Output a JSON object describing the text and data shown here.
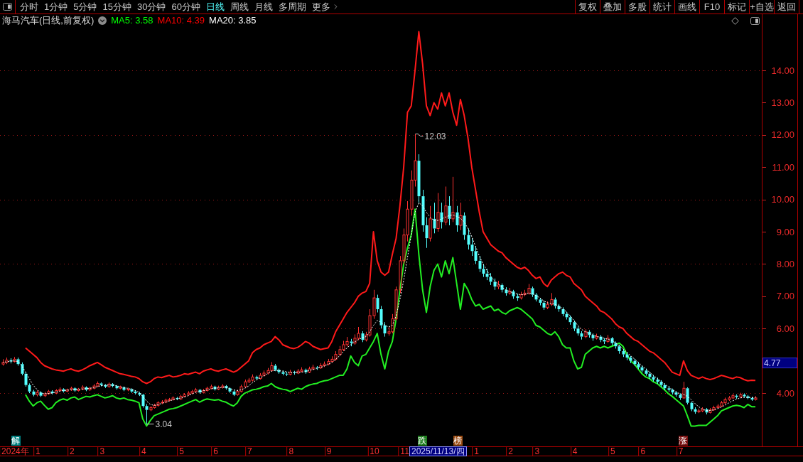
{
  "toolbar": {
    "periods": [
      {
        "label": "分时",
        "selected": false,
        "kind": "tab"
      },
      {
        "label": "1分钟",
        "selected": false,
        "kind": "tab"
      },
      {
        "label": "5分钟",
        "selected": false,
        "kind": "tab"
      },
      {
        "label": "15分钟",
        "selected": false,
        "kind": "tab"
      },
      {
        "label": "30分钟",
        "selected": false,
        "kind": "tab"
      },
      {
        "label": "60分钟",
        "selected": false,
        "kind": "tab"
      },
      {
        "label": "日线",
        "selected": true,
        "kind": "tab"
      },
      {
        "label": "周线",
        "selected": false,
        "kind": "tab"
      },
      {
        "label": "月线",
        "selected": false,
        "kind": "tab"
      },
      {
        "label": "多周期",
        "selected": false,
        "kind": "tab"
      },
      {
        "label": "更多",
        "selected": false,
        "kind": "menu"
      }
    ],
    "actions": [
      "复权",
      "叠加",
      "多股",
      "统计",
      "画线",
      "F10",
      "标记",
      "+自选",
      "返回"
    ]
  },
  "chart": {
    "title": "海马汽车(日线,前复权)",
    "indicators": [
      {
        "text": "MA5: 3.58",
        "color": "#00ff00"
      },
      {
        "text": "MA10: 4.39",
        "color": "#ff0000"
      },
      {
        "text": "MA20: 3.85",
        "color": "#ffffff"
      }
    ],
    "current_price": "4.77",
    "event_flags": [
      {
        "text": "解",
        "color": "#008080"
      },
      {
        "text": "跌",
        "color": "#1e7d1e"
      },
      {
        "text": "榜",
        "color": "#9a4a10"
      },
      {
        "text": "涨",
        "color": "#7a1010"
      }
    ],
    "cursor_date": "2025/11/13/四",
    "chart_data": [
      {
        "type": "candlestick",
        "categories": [
          null,
          null,
          null,
          "2024年",
          null,
          null,
          null,
          null,
          null,
          "1",
          null,
          null,
          null,
          null,
          null,
          null,
          null,
          null,
          "2",
          null,
          null,
          null,
          null,
          null,
          null,
          null,
          "3",
          null,
          null,
          null,
          null,
          null,
          null,
          null,
          null,
          null,
          null,
          "4",
          null,
          null,
          null,
          null,
          null,
          null,
          null,
          null,
          null,
          "5",
          null,
          null,
          null,
          null,
          null,
          null,
          null,
          null,
          "6",
          null,
          null,
          null,
          null,
          null,
          null,
          null,
          null,
          "7",
          null,
          null,
          null,
          null,
          null,
          null,
          null,
          null,
          null,
          null,
          "8",
          null,
          null,
          null,
          null,
          null,
          null,
          null,
          null,
          null,
          "9",
          null,
          null,
          null,
          null,
          null,
          null,
          null,
          null,
          null,
          null,
          null,
          "10",
          null,
          null,
          null,
          null,
          null,
          null,
          null,
          "11",
          null,
          null,
          null,
          null,
          null,
          null,
          null,
          null,
          null,
          null,
          null,
          null,
          null,
          null,
          null,
          null,
          null,
          null,
          "1",
          null,
          null,
          null,
          null,
          null,
          null,
          null,
          null,
          "2",
          null,
          null,
          null,
          null,
          null,
          null,
          "3",
          null,
          null,
          null,
          null,
          null,
          null,
          null,
          null,
          null,
          "4",
          null,
          null,
          null,
          null,
          null,
          null,
          null,
          null,
          null,
          "5",
          null,
          null,
          null,
          null,
          null,
          null,
          null,
          "6",
          null,
          null,
          null,
          null,
          null,
          null,
          null,
          null,
          null,
          "7",
          null,
          null,
          null,
          null,
          null,
          null,
          null,
          null,
          null,
          null,
          null,
          null,
          null,
          null,
          null,
          null,
          null,
          null,
          null,
          null
        ],
        "ohlc": [
          [
            4.9,
            5.05,
            4.85,
            4.95
          ],
          [
            4.95,
            5.1,
            4.9,
            5.02
          ],
          [
            5.02,
            5.08,
            4.92,
            4.98
          ],
          [
            4.98,
            5.12,
            4.95,
            5.05
          ],
          [
            5.05,
            5.1,
            4.85,
            4.9
          ],
          [
            4.9,
            4.95,
            4.55,
            4.6
          ],
          [
            4.6,
            4.65,
            4.2,
            4.25
          ],
          [
            4.25,
            4.3,
            4.0,
            4.05
          ],
          [
            4.05,
            4.1,
            3.9,
            3.95
          ],
          [
            3.95,
            4.08,
            3.9,
            4.02
          ],
          [
            4.02,
            4.06,
            3.88,
            3.92
          ],
          [
            3.92,
            4.04,
            3.88,
            3.98
          ],
          [
            3.98,
            4.1,
            3.95,
            4.05
          ],
          [
            4.05,
            4.09,
            3.96,
            4.0
          ],
          [
            4.0,
            4.12,
            3.97,
            4.08
          ],
          [
            4.08,
            4.18,
            4.04,
            4.12
          ],
          [
            4.12,
            4.15,
            4.02,
            4.06
          ],
          [
            4.06,
            4.14,
            4.03,
            4.1
          ],
          [
            4.1,
            4.2,
            4.07,
            4.15
          ],
          [
            4.15,
            4.18,
            4.04,
            4.08
          ],
          [
            4.08,
            4.16,
            4.05,
            4.12
          ],
          [
            4.12,
            4.24,
            4.09,
            4.18
          ],
          [
            4.18,
            4.21,
            4.06,
            4.1
          ],
          [
            4.1,
            4.19,
            4.07,
            4.15
          ],
          [
            4.15,
            4.28,
            4.12,
            4.22
          ],
          [
            4.22,
            4.36,
            4.19,
            4.3
          ],
          [
            4.3,
            4.33,
            4.21,
            4.25
          ],
          [
            4.25,
            4.28,
            4.16,
            4.2
          ],
          [
            4.2,
            4.33,
            4.17,
            4.28
          ],
          [
            4.28,
            4.31,
            4.18,
            4.22
          ],
          [
            4.22,
            4.25,
            4.11,
            4.15
          ],
          [
            4.15,
            4.23,
            4.12,
            4.18
          ],
          [
            4.18,
            4.21,
            4.06,
            4.1
          ],
          [
            4.1,
            4.17,
            4.06,
            4.12
          ],
          [
            4.12,
            4.15,
            4.01,
            4.05
          ],
          [
            4.05,
            4.09,
            3.96,
            4.0
          ],
          [
            4.0,
            4.04,
            3.91,
            3.95
          ],
          [
            3.95,
            3.98,
            3.55,
            3.6
          ],
          [
            3.6,
            3.66,
            3.04,
            3.48
          ],
          [
            3.48,
            3.6,
            3.44,
            3.55
          ],
          [
            3.55,
            3.67,
            3.52,
            3.62
          ],
          [
            3.62,
            3.75,
            3.58,
            3.7
          ],
          [
            3.7,
            3.78,
            3.66,
            3.72
          ],
          [
            3.72,
            3.83,
            3.69,
            3.78
          ],
          [
            3.78,
            3.85,
            3.74,
            3.8
          ],
          [
            3.8,
            3.9,
            3.77,
            3.85
          ],
          [
            3.85,
            3.88,
            3.78,
            3.82
          ],
          [
            3.82,
            3.95,
            3.79,
            3.9
          ],
          [
            3.9,
            4.0,
            3.87,
            3.95
          ],
          [
            3.95,
            4.06,
            3.92,
            4.0
          ],
          [
            4.0,
            4.1,
            3.97,
            4.05
          ],
          [
            4.05,
            4.16,
            4.02,
            4.1
          ],
          [
            4.1,
            4.13,
            3.98,
            4.02
          ],
          [
            4.02,
            4.13,
            3.99,
            4.08
          ],
          [
            4.08,
            4.2,
            4.05,
            4.15
          ],
          [
            4.15,
            4.26,
            4.12,
            4.2
          ],
          [
            4.2,
            4.23,
            4.08,
            4.12
          ],
          [
            4.12,
            4.23,
            4.09,
            4.18
          ],
          [
            4.18,
            4.28,
            4.14,
            4.22
          ],
          [
            4.22,
            4.25,
            4.11,
            4.15
          ],
          [
            4.15,
            4.18,
            4.01,
            4.05
          ],
          [
            4.05,
            4.08,
            3.91,
            3.95
          ],
          [
            3.95,
            4.1,
            3.92,
            4.05
          ],
          [
            4.05,
            4.26,
            4.02,
            4.2
          ],
          [
            4.2,
            4.42,
            4.17,
            4.35
          ],
          [
            4.35,
            4.47,
            4.31,
            4.4
          ],
          [
            4.4,
            4.58,
            4.36,
            4.5
          ],
          [
            4.5,
            4.54,
            4.4,
            4.45
          ],
          [
            4.45,
            4.62,
            4.42,
            4.55
          ],
          [
            4.55,
            4.7,
            4.51,
            4.62
          ],
          [
            4.62,
            4.78,
            4.58,
            4.7
          ],
          [
            4.7,
            4.96,
            4.66,
            4.85
          ],
          [
            4.85,
            4.9,
            4.68,
            4.72
          ],
          [
            4.72,
            4.76,
            4.6,
            4.65
          ],
          [
            4.65,
            4.7,
            4.55,
            4.6
          ],
          [
            4.6,
            4.66,
            4.53,
            4.58
          ],
          [
            4.58,
            4.72,
            4.55,
            4.65
          ],
          [
            4.65,
            4.69,
            4.57,
            4.62
          ],
          [
            4.62,
            4.75,
            4.59,
            4.68
          ],
          [
            4.68,
            4.8,
            4.64,
            4.72
          ],
          [
            4.72,
            4.76,
            4.6,
            4.65
          ],
          [
            4.65,
            4.82,
            4.62,
            4.75
          ],
          [
            4.75,
            4.88,
            4.71,
            4.8
          ],
          [
            4.8,
            4.84,
            4.72,
            4.78
          ],
          [
            4.78,
            4.93,
            4.75,
            4.85
          ],
          [
            4.85,
            4.98,
            4.81,
            4.9
          ],
          [
            4.9,
            5.06,
            4.86,
            4.98
          ],
          [
            4.98,
            5.14,
            4.94,
            5.05
          ],
          [
            5.05,
            5.3,
            5.0,
            5.2
          ],
          [
            5.2,
            5.46,
            5.15,
            5.35
          ],
          [
            5.35,
            5.62,
            5.3,
            5.5
          ],
          [
            5.5,
            5.74,
            5.44,
            5.6
          ],
          [
            5.6,
            5.68,
            5.45,
            5.55
          ],
          [
            5.55,
            5.82,
            5.5,
            5.7
          ],
          [
            5.7,
            6.05,
            5.64,
            5.85
          ],
          [
            5.85,
            5.92,
            5.58,
            5.65
          ],
          [
            5.65,
            5.9,
            5.6,
            5.8
          ],
          [
            5.8,
            6.6,
            5.75,
            6.4
          ],
          [
            6.4,
            7.2,
            6.3,
            6.95
          ],
          [
            6.95,
            7.05,
            6.5,
            6.6
          ],
          [
            6.6,
            6.7,
            6.0,
            6.1
          ],
          [
            6.1,
            6.2,
            5.75,
            5.85
          ],
          [
            5.85,
            6.05,
            5.78,
            5.9
          ],
          [
            5.9,
            6.45,
            5.85,
            6.3
          ],
          [
            6.3,
            7.3,
            6.25,
            7.2
          ],
          [
            7.2,
            8.25,
            7.1,
            8.1
          ],
          [
            8.1,
            9.1,
            8.0,
            8.9
          ],
          [
            8.9,
            9.95,
            8.7,
            9.7
          ],
          [
            9.7,
            10.9,
            9.5,
            10.6
          ],
          [
            10.6,
            12.03,
            10.4,
            11.2
          ],
          [
            11.2,
            11.4,
            9.9,
            10.1
          ],
          [
            10.1,
            10.3,
            9.0,
            9.2
          ],
          [
            9.2,
            9.45,
            8.5,
            8.8
          ],
          [
            8.8,
            9.8,
            8.7,
            9.4
          ],
          [
            9.4,
            9.9,
            8.95,
            9.1
          ],
          [
            9.1,
            10.2,
            9.0,
            9.6
          ],
          [
            9.6,
            9.9,
            9.1,
            9.3
          ],
          [
            9.3,
            10.4,
            9.2,
            9.8
          ],
          [
            9.8,
            10.1,
            9.2,
            9.4
          ],
          [
            9.4,
            10.7,
            9.3,
            9.6
          ],
          [
            9.6,
            9.8,
            9.0,
            9.2
          ],
          [
            9.2,
            9.9,
            9.05,
            9.5
          ],
          [
            9.5,
            9.6,
            8.75,
            8.9
          ],
          [
            8.9,
            9.1,
            8.45,
            8.6
          ],
          [
            8.6,
            8.8,
            8.25,
            8.4
          ],
          [
            8.4,
            8.55,
            8.0,
            8.1
          ],
          [
            8.1,
            8.25,
            7.75,
            7.85
          ],
          [
            7.85,
            8.0,
            7.6,
            7.7
          ],
          [
            7.7,
            7.85,
            7.5,
            7.6
          ],
          [
            7.6,
            7.72,
            7.35,
            7.45
          ],
          [
            7.45,
            7.55,
            7.2,
            7.3
          ],
          [
            7.3,
            7.48,
            7.22,
            7.35
          ],
          [
            7.35,
            7.4,
            7.12,
            7.2
          ],
          [
            7.2,
            7.28,
            7.02,
            7.1
          ],
          [
            7.1,
            7.26,
            7.05,
            7.15
          ],
          [
            7.15,
            7.2,
            6.92,
            7.0
          ],
          [
            7.0,
            7.08,
            6.86,
            6.95
          ],
          [
            6.95,
            7.14,
            6.9,
            7.05
          ],
          [
            7.05,
            7.2,
            7.0,
            7.1
          ],
          [
            7.1,
            7.38,
            7.05,
            7.25
          ],
          [
            7.25,
            7.3,
            6.98,
            7.05
          ],
          [
            7.05,
            7.1,
            6.84,
            6.9
          ],
          [
            6.9,
            6.95,
            6.72,
            6.8
          ],
          [
            6.8,
            6.86,
            6.58,
            6.65
          ],
          [
            6.65,
            6.84,
            6.6,
            6.75
          ],
          [
            6.75,
            7.1,
            6.7,
            6.9
          ],
          [
            6.9,
            6.96,
            6.62,
            6.7
          ],
          [
            6.7,
            6.76,
            6.52,
            6.6
          ],
          [
            6.6,
            6.66,
            6.38,
            6.45
          ],
          [
            6.45,
            6.52,
            6.28,
            6.35
          ],
          [
            6.35,
            6.4,
            6.12,
            6.2
          ],
          [
            6.2,
            6.25,
            5.92,
            6.0
          ],
          [
            6.0,
            6.06,
            5.78,
            5.85
          ],
          [
            5.85,
            5.92,
            5.66,
            5.75
          ],
          [
            5.75,
            5.98,
            5.7,
            5.9
          ],
          [
            5.9,
            5.95,
            5.72,
            5.8
          ],
          [
            5.8,
            5.85,
            5.62,
            5.7
          ],
          [
            5.7,
            5.84,
            5.66,
            5.75
          ],
          [
            5.75,
            5.8,
            5.58,
            5.65
          ],
          [
            5.65,
            5.7,
            5.52,
            5.6
          ],
          [
            5.6,
            5.8,
            5.56,
            5.7
          ],
          [
            5.7,
            5.74,
            5.48,
            5.55
          ],
          [
            5.55,
            5.6,
            5.38,
            5.45
          ],
          [
            5.45,
            5.5,
            5.22,
            5.3
          ],
          [
            5.3,
            5.36,
            5.12,
            5.2
          ],
          [
            5.2,
            5.26,
            5.02,
            5.1
          ],
          [
            5.1,
            5.15,
            4.93,
            5.0
          ],
          [
            5.0,
            5.06,
            4.84,
            4.9
          ],
          [
            4.9,
            4.96,
            4.74,
            4.8
          ],
          [
            4.8,
            4.86,
            4.64,
            4.7
          ],
          [
            4.7,
            4.76,
            4.54,
            4.6
          ],
          [
            4.6,
            4.66,
            4.44,
            4.5
          ],
          [
            4.5,
            4.56,
            4.36,
            4.42
          ],
          [
            4.42,
            4.48,
            4.29,
            4.35
          ],
          [
            4.35,
            4.4,
            4.19,
            4.25
          ],
          [
            4.25,
            4.3,
            4.09,
            4.15
          ],
          [
            4.15,
            4.22,
            4.04,
            4.1
          ],
          [
            4.1,
            4.14,
            3.96,
            4.02
          ],
          [
            4.02,
            4.06,
            3.89,
            3.95
          ],
          [
            3.95,
            3.99,
            3.79,
            3.85
          ],
          [
            3.85,
            4.35,
            3.82,
            4.15
          ],
          [
            4.15,
            4.18,
            3.65,
            3.7
          ],
          [
            3.7,
            3.74,
            3.44,
            3.5
          ],
          [
            3.5,
            3.56,
            3.36,
            3.42
          ],
          [
            3.42,
            3.52,
            3.38,
            3.45
          ],
          [
            3.45,
            3.56,
            3.41,
            3.5
          ],
          [
            3.5,
            3.54,
            3.34,
            3.4
          ],
          [
            3.4,
            3.54,
            3.37,
            3.48
          ],
          [
            3.48,
            3.61,
            3.45,
            3.55
          ],
          [
            3.55,
            3.66,
            3.52,
            3.6
          ],
          [
            3.6,
            3.76,
            3.57,
            3.7
          ],
          [
            3.7,
            3.86,
            3.66,
            3.8
          ],
          [
            3.8,
            3.91,
            3.76,
            3.85
          ],
          [
            3.85,
            3.98,
            3.82,
            3.92
          ],
          [
            3.92,
            3.96,
            3.83,
            3.88
          ],
          [
            3.88,
            4.01,
            3.85,
            3.95
          ],
          [
            3.95,
            3.99,
            3.86,
            3.9
          ],
          [
            3.9,
            3.94,
            3.81,
            3.85
          ],
          [
            3.85,
            3.89,
            3.76,
            3.8
          ],
          [
            3.8,
            3.91,
            3.77,
            3.85
          ]
        ],
        "series": [
          {
            "type": "line",
            "color": "#22ee22",
            "values": [
              null,
              null,
              null,
              null,
              null,
              null,
              3.95,
              3.75,
              3.6,
              3.7,
              3.75,
              3.62,
              3.5,
              3.55,
              3.7,
              3.78,
              3.82,
              3.78,
              3.85,
              3.88,
              3.8,
              3.85,
              3.9,
              3.88,
              3.92,
              3.95,
              3.9,
              3.85,
              3.88,
              3.92,
              3.85,
              3.82,
              3.85,
              3.8,
              3.78,
              3.75,
              3.7,
              3.2,
              2.98,
              3.15,
              3.3,
              3.35,
              3.4,
              3.45,
              3.5,
              3.52,
              3.55,
              3.6,
              3.65,
              3.7,
              3.75,
              3.8,
              3.72,
              3.78,
              3.82,
              3.8,
              3.78,
              3.8,
              3.75,
              3.72,
              3.65,
              3.6,
              3.7,
              3.9,
              4.0,
              4.05,
              4.1,
              4.12,
              4.15,
              4.2,
              4.22,
              4.3,
              4.2,
              4.15,
              4.12,
              4.1,
              4.05,
              4.1,
              4.15,
              4.12,
              4.2,
              4.25,
              4.28,
              4.3,
              4.35,
              4.38,
              4.4,
              4.45,
              4.5,
              4.55,
              4.55,
              4.75,
              5.15,
              4.95,
              4.85,
              5.15,
              5.2,
              5.4,
              5.6,
              5.85,
              5.2,
              4.75,
              5.3,
              5.6,
              6.3,
              7.2,
              8.0,
              8.5,
              8.9,
              9.7,
              8.3,
              7.2,
              6.5,
              7.3,
              7.8,
              8.0,
              7.6,
              8.1,
              7.7,
              8.2,
              7.4,
              6.6,
              7.4,
              7.2,
              6.9,
              6.7,
              6.75,
              6.6,
              6.65,
              6.7,
              6.55,
              6.6,
              6.5,
              6.45,
              6.55,
              6.6,
              6.65,
              6.6,
              6.5,
              6.4,
              6.3,
              6.1,
              6.05,
              5.95,
              5.85,
              5.8,
              5.9,
              5.75,
              5.5,
              5.4,
              5.4,
              5.0,
              4.75,
              4.8,
              5.2,
              5.3,
              5.4,
              5.45,
              5.4,
              5.45,
              5.4,
              5.45,
              5.5,
              5.55,
              5.45,
              5.2,
              5.0,
              4.9,
              4.75,
              4.6,
              4.5,
              4.45,
              4.35,
              4.3,
              4.2,
              4.1,
              3.98,
              3.9,
              3.8,
              3.7,
              3.6,
              3.3,
              2.98,
              2.98,
              3.0,
              3.0,
              3.0,
              3.1,
              3.2,
              3.3,
              3.45,
              3.5,
              3.55,
              3.6,
              3.62,
              3.6,
              3.55,
              3.65,
              3.58,
              3.58
            ]
          },
          {
            "type": "line",
            "color": "#ff1a1a",
            "values": [
              null,
              null,
              null,
              null,
              null,
              null,
              5.4,
              5.3,
              5.2,
              5.1,
              4.95,
              4.85,
              4.8,
              4.75,
              4.72,
              4.7,
              4.68,
              4.72,
              4.75,
              4.7,
              4.68,
              4.72,
              4.78,
              4.85,
              4.9,
              4.95,
              4.88,
              4.8,
              4.75,
              4.7,
              4.65,
              4.6,
              4.58,
              4.55,
              4.52,
              4.5,
              4.45,
              4.35,
              4.3,
              4.35,
              4.45,
              4.5,
              4.48,
              4.52,
              4.55,
              4.5,
              4.52,
              4.55,
              4.6,
              4.58,
              4.62,
              4.65,
              4.6,
              4.68,
              4.72,
              4.75,
              4.7,
              4.68,
              4.72,
              4.75,
              4.7,
              4.65,
              4.7,
              4.8,
              4.9,
              5.0,
              5.25,
              5.35,
              5.4,
              5.5,
              5.55,
              5.6,
              5.75,
              5.65,
              5.5,
              5.45,
              5.4,
              5.38,
              5.42,
              5.5,
              5.6,
              5.55,
              5.45,
              5.4,
              5.35,
              5.38,
              5.4,
              5.6,
              5.9,
              6.1,
              6.3,
              6.5,
              6.65,
              6.8,
              7.0,
              7.1,
              7.15,
              7.4,
              9.0,
              8.1,
              7.75,
              7.65,
              7.75,
              8.3,
              8.8,
              9.8,
              11.0,
              12.7,
              12.9,
              14.0,
              15.2,
              14.2,
              12.9,
              12.6,
              13.0,
              12.8,
              13.3,
              12.9,
              13.3,
              12.7,
              12.3,
              13.1,
              12.6,
              11.9,
              11.0,
              10.3,
              9.6,
              9.0,
              8.8,
              8.6,
              8.5,
              8.4,
              8.35,
              8.2,
              8.1,
              8.0,
              7.9,
              7.85,
              7.9,
              7.8,
              7.65,
              7.55,
              7.6,
              7.4,
              7.3,
              7.5,
              7.6,
              7.7,
              7.75,
              7.65,
              7.6,
              7.4,
              7.3,
              7.2,
              7.0,
              6.9,
              6.8,
              6.7,
              6.55,
              6.5,
              6.4,
              6.3,
              6.15,
              6.05,
              6.0,
              5.85,
              5.75,
              5.65,
              5.6,
              5.5,
              5.4,
              5.3,
              5.25,
              5.15,
              5.05,
              4.95,
              4.8,
              4.65,
              4.6,
              4.55,
              5.0,
              4.7,
              4.55,
              4.5,
              4.45,
              4.5,
              4.45,
              4.42,
              4.45,
              4.5,
              4.55,
              4.52,
              4.48,
              4.45,
              4.5,
              4.48,
              4.42,
              4.38,
              4.4,
              4.39
            ]
          },
          {
            "type": "line",
            "color": "#ffffff",
            "line_style": "dotted",
            "values": [
              4.95,
              4.97,
              4.99,
              5.0,
              4.98,
              4.85,
              4.65,
              4.45,
              4.25,
              4.12,
              4.0,
              3.98,
              3.99,
              4.0,
              4.03,
              4.06,
              4.08,
              4.09,
              4.1,
              4.11,
              4.12,
              4.13,
              4.14,
              4.15,
              4.17,
              4.2,
              4.23,
              4.24,
              4.25,
              4.25,
              4.23,
              4.2,
              4.17,
              4.15,
              4.12,
              4.08,
              4.02,
              3.9,
              3.75,
              3.65,
              3.62,
              3.64,
              3.68,
              3.72,
              3.76,
              3.79,
              3.82,
              3.85,
              3.88,
              3.92,
              3.97,
              4.02,
              4.05,
              4.07,
              4.1,
              4.13,
              4.15,
              4.16,
              4.18,
              4.18,
              4.14,
              4.1,
              4.08,
              4.1,
              4.15,
              4.22,
              4.32,
              4.4,
              4.47,
              4.53,
              4.6,
              4.68,
              4.7,
              4.7,
              4.68,
              4.66,
              4.64,
              4.63,
              4.64,
              4.65,
              4.67,
              4.7,
              4.73,
              4.76,
              4.8,
              4.84,
              4.89,
              4.95,
              5.05,
              5.15,
              5.28,
              5.4,
              5.5,
              5.58,
              5.66,
              5.71,
              5.75,
              5.9,
              6.1,
              6.25,
              6.2,
              6.1,
              6.05,
              6.1,
              6.4,
              6.9,
              7.5,
              8.2,
              8.9,
              9.6,
              9.9,
              9.8,
              9.6,
              9.45,
              9.35,
              9.35,
              9.4,
              9.45,
              9.5,
              9.52,
              9.48,
              9.42,
              9.3,
              9.1,
              8.85,
              8.55,
              8.25,
              8.0,
              7.8,
              7.62,
              7.48,
              7.38,
              7.28,
              7.2,
              7.15,
              7.1,
              7.07,
              7.05,
              7.06,
              7.1,
              7.08,
              7.02,
              6.95,
              6.86,
              6.8,
              6.78,
              6.75,
              6.7,
              6.62,
              6.52,
              6.4,
              6.25,
              6.1,
              5.98,
              5.9,
              5.85,
              5.8,
              5.76,
              5.73,
              5.7,
              5.67,
              5.63,
              5.56,
              5.47,
              5.37,
              5.27,
              5.16,
              5.06,
              4.96,
              4.85,
              4.75,
              4.65,
              4.55,
              4.46,
              4.37,
              4.28,
              4.19,
              4.11,
              4.04,
              3.98,
              3.96,
              3.9,
              3.8,
              3.68,
              3.58,
              3.5,
              3.46,
              3.46,
              3.48,
              3.52,
              3.57,
              3.63,
              3.7,
              3.76,
              3.81,
              3.85,
              3.87,
              3.87,
              3.86,
              3.85
            ]
          }
        ],
        "ylim": [
          2.35,
          15.74
        ],
        "yticks": [
          {
            "value": 4,
            "label": "4.00"
          },
          {
            "value": 6,
            "label": "6.00"
          },
          {
            "value": 7,
            "label": "7.00"
          },
          {
            "value": 8,
            "label": "8.00"
          },
          {
            "value": 9,
            "label": "9.00"
          },
          {
            "value": 10,
            "label": "10.00"
          },
          {
            "value": 11,
            "label": "11.00"
          },
          {
            "value": 12,
            "label": "12.00"
          },
          {
            "value": 13,
            "label": "13.00"
          },
          {
            "value": 14,
            "label": "14.00"
          }
        ],
        "grid": true,
        "annotations": [
          "12.03",
          "3.04"
        ]
      }
    ]
  }
}
